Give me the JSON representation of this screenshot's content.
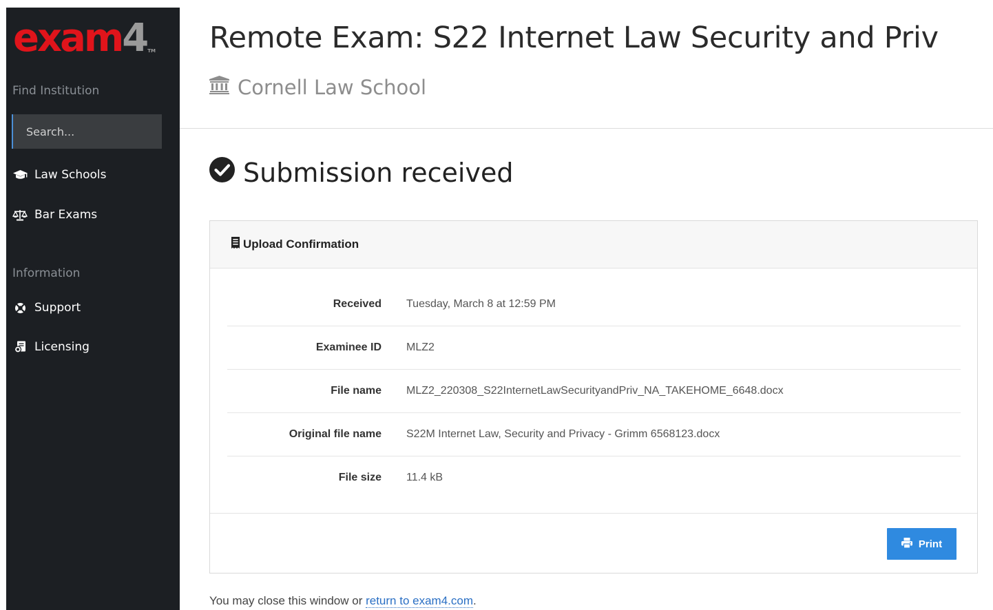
{
  "sidebar": {
    "logo_main": "exam",
    "logo_digit": "4",
    "logo_tm": "TM",
    "find_institution_heading": "Find Institution",
    "search_placeholder": "Search...",
    "nav": [
      {
        "label": "Law Schools",
        "icon": "graduation-cap-icon"
      },
      {
        "label": "Bar Exams",
        "icon": "balance-scale-icon"
      }
    ],
    "information_heading": "Information",
    "info_nav": [
      {
        "label": "Support",
        "icon": "life-ring-icon"
      },
      {
        "label": "Licensing",
        "icon": "license-document-icon"
      }
    ]
  },
  "main": {
    "title": "Remote Exam: S22 Internet Law Security and Priv",
    "institution": "Cornell Law School",
    "status": "Submission received",
    "card": {
      "header": "Upload Confirmation",
      "rows": [
        {
          "label": "Received",
          "value": "Tuesday, March 8 at 12:59 PM"
        },
        {
          "label": "Examinee ID",
          "value": "MLZ2"
        },
        {
          "label": "File name",
          "value": "MLZ2_220308_S22InternetLawSecurityandPriv_NA_TAKEHOME_6648.docx"
        },
        {
          "label": "Original file name",
          "value": "S22M Internet Law, Security and Privacy - Grimm 6568123.docx"
        },
        {
          "label": "File size",
          "value": "11.4 kB"
        }
      ],
      "print_label": "Print"
    },
    "footer_prefix": "You may close this window or ",
    "footer_link": "return to exam4.com",
    "footer_suffix": "."
  },
  "colors": {
    "sidebar_bg": "#1c1f23",
    "logo_red": "#e0141b",
    "accent_blue": "#2f8ae0",
    "link_blue": "#2a6fc4"
  }
}
